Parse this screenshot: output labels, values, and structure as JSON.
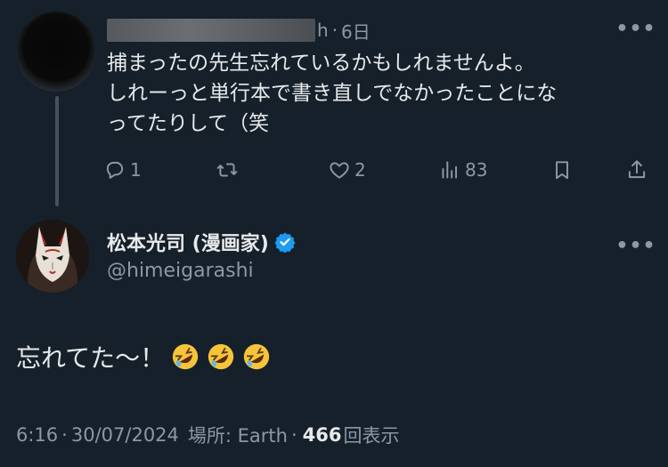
{
  "reply_tweet": {
    "handle_suffix": "h",
    "separator": "·",
    "time": "6日",
    "text_lines": [
      "捕まったの先生忘れているかもしれませんよ。",
      "しれーっと単行本で書き直しでなかったことにな",
      "ってたりして（笑"
    ],
    "actions": {
      "reply_count": "1",
      "retweet_count": "",
      "like_count": "2",
      "view_count": "83"
    },
    "more_label": "•••"
  },
  "main_tweet": {
    "display_name": "松本光司 (漫画家)",
    "handle": "@himeigarashi",
    "text": "忘れてた〜！",
    "emoji": [
      "rolling-on-floor-laughing",
      "rolling-on-floor-laughing",
      "rolling-on-floor-laughing"
    ],
    "more_label": "•••",
    "meta": {
      "time": "6:16",
      "sep1": "·",
      "date": "30/07/2024",
      "location": "場所: Earth",
      "sep2": "·",
      "views_count": "466",
      "views_label": "回表示"
    }
  },
  "colors": {
    "background": "#15202b",
    "text": "#e7e9ea",
    "secondary": "#8b98a5",
    "verified": "#1d9bf0"
  }
}
